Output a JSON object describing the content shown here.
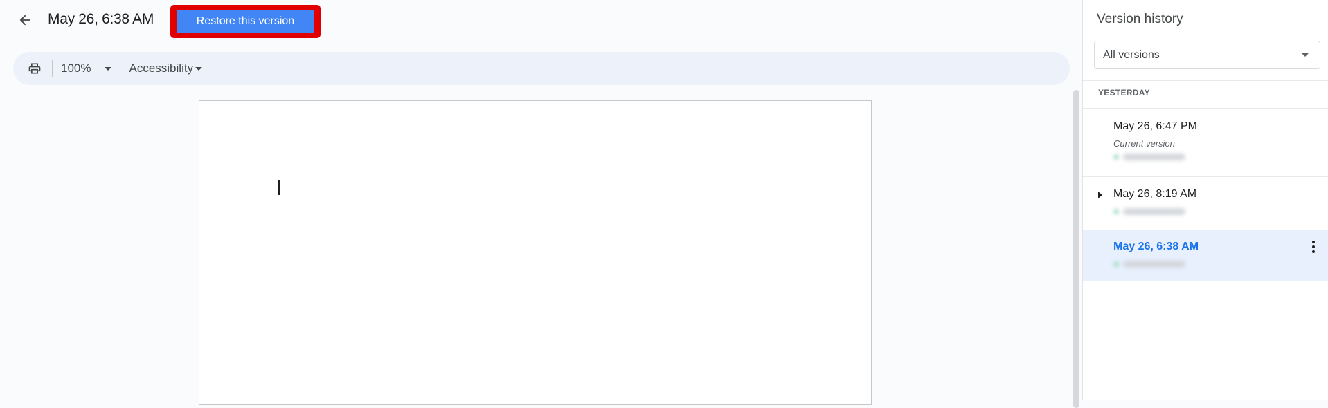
{
  "header": {
    "back_icon": "arrow-left-icon",
    "title": "May 26, 6:38 AM",
    "restore_button": "Restore this version",
    "highlight_color": "#e00000",
    "button_color": "#4285f4"
  },
  "toolbar": {
    "print_icon": "printer-icon",
    "zoom": "100%",
    "accessibility": "Accessibility"
  },
  "panel": {
    "title": "Version history",
    "filter": {
      "selected": "All versions"
    },
    "section": "YESTERDAY",
    "versions": [
      {
        "time": "May 26, 6:47 PM",
        "subtitle": "Current version",
        "expandable": false,
        "selected": false
      },
      {
        "time": "May 26, 8:19 AM",
        "subtitle": "",
        "expandable": true,
        "selected": false
      },
      {
        "time": "May 26, 6:38 AM",
        "subtitle": "",
        "expandable": false,
        "selected": true
      }
    ],
    "accent_color": "#1a73e8",
    "selected_bg": "#e8f0fe"
  }
}
